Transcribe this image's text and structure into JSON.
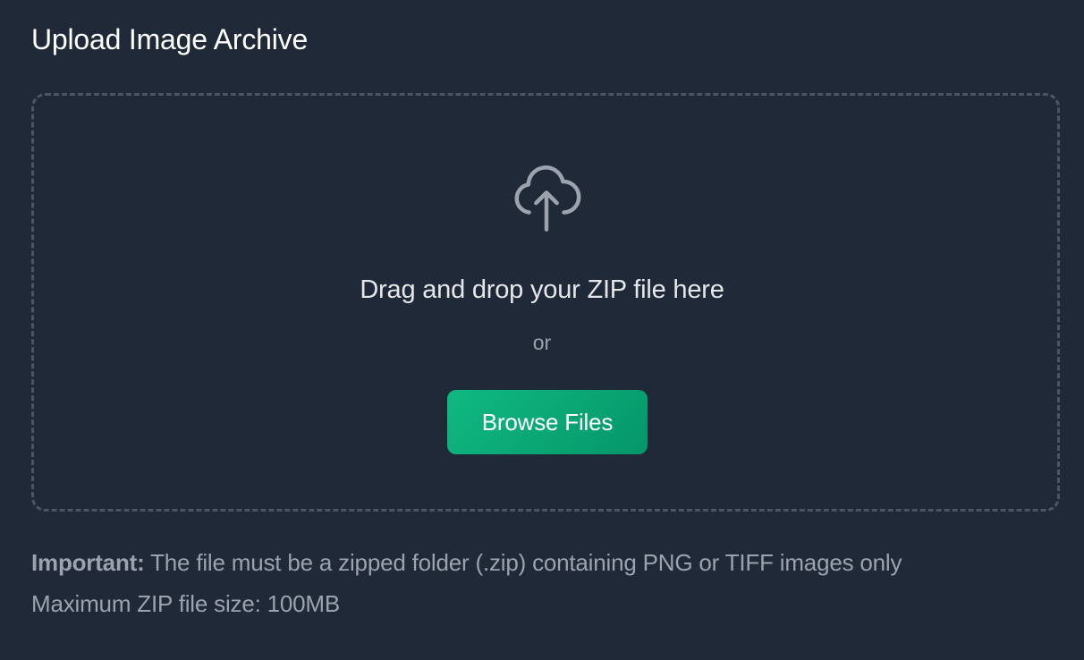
{
  "upload": {
    "title": "Upload Image Archive",
    "icon": "cloud-upload-icon",
    "drop_text": "Drag and drop your ZIP file here",
    "or_text": "or",
    "browse_label": "Browse Files",
    "important_label": "Important:",
    "important_text": " The file must be a zipped folder (.zip) containing PNG or TIFF images only",
    "max_size_text": "Maximum ZIP file size: 100MB"
  },
  "colors": {
    "background": "#1f2937",
    "dropzone_border": "#4b5563",
    "accent_start": "#10b981",
    "accent_end": "#059669",
    "muted_text": "#9ca3af",
    "icon": "#9ca3af"
  }
}
